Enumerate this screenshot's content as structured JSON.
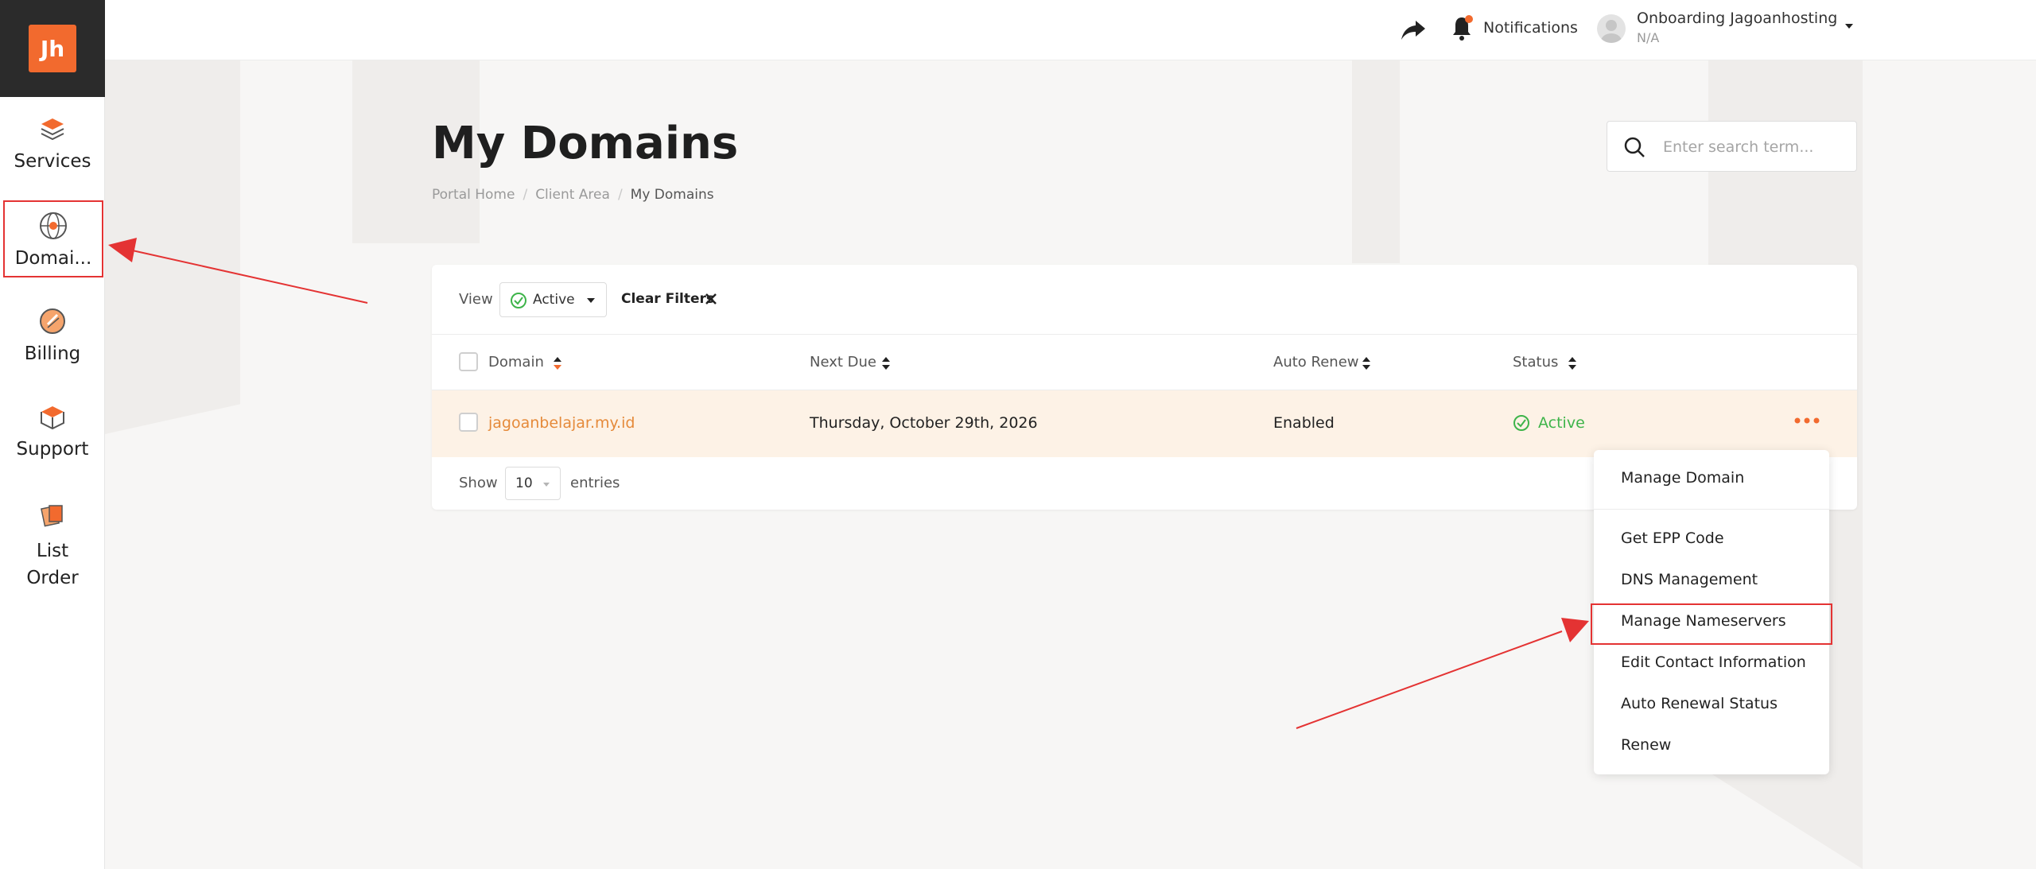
{
  "colors": {
    "accent": "#f26a2e",
    "link": "#e58a3a",
    "success": "#3eb44a",
    "annotation": "#e43333"
  },
  "sidebar": {
    "logo_text": "Jh",
    "items": [
      {
        "label": "Services",
        "icon": "services-icon"
      },
      {
        "label": "Domai...",
        "icon": "domains-icon"
      },
      {
        "label": "Billing",
        "icon": "billing-icon"
      },
      {
        "label": "Support",
        "icon": "support-icon"
      },
      {
        "label": "List Order",
        "icon": "list-order-icon"
      }
    ]
  },
  "header": {
    "notifications_label": "Notifications",
    "user_name": "Onboarding Jagoanhosting",
    "user_sub": "N/A"
  },
  "page": {
    "title": "My Domains",
    "breadcrumbs": [
      "Portal Home",
      "Client Area",
      "My Domains"
    ],
    "search_placeholder": "Enter search term..."
  },
  "filters": {
    "view_label": "View",
    "view_value": "Active",
    "clear_label": "Clear Filters"
  },
  "table": {
    "columns": [
      "Domain",
      "Next Due",
      "Auto Renew",
      "Status"
    ],
    "rows": [
      {
        "domain": "jagoanbelajar.my.id",
        "next_due": "Thursday, October 29th, 2026",
        "auto_renew": "Enabled",
        "status": "Active"
      }
    ],
    "show_label": "Show",
    "page_size": "10",
    "entries_label": "entries"
  },
  "menu": {
    "items": [
      "Manage Domain",
      "Get EPP Code",
      "DNS Management",
      "Manage Nameservers",
      "Edit Contact Information",
      "Auto Renewal Status",
      "Renew"
    ]
  }
}
